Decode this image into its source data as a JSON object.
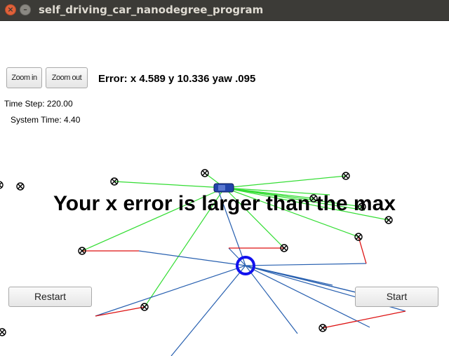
{
  "window": {
    "title": "self_driving_car_nanodegree_program"
  },
  "controls": {
    "zoom_in": "Zoom in",
    "zoom_out": "Zoom out",
    "restart": "Restart",
    "start": "Start"
  },
  "status": {
    "error_text": "Error: x 4.589 y 10.336 yaw .095",
    "time_step": "Time Step: 220.00",
    "system_time": "System Time: 4.40"
  },
  "message": "Your x error is larger than the max",
  "colors": {
    "observation_lines": "#33dd33",
    "particle_lines": "#2860b0",
    "association_lines": "#dd1111",
    "estimate_ring": "#1111ee",
    "car": "#2244aa",
    "titlebar": "#3c3b37"
  }
}
